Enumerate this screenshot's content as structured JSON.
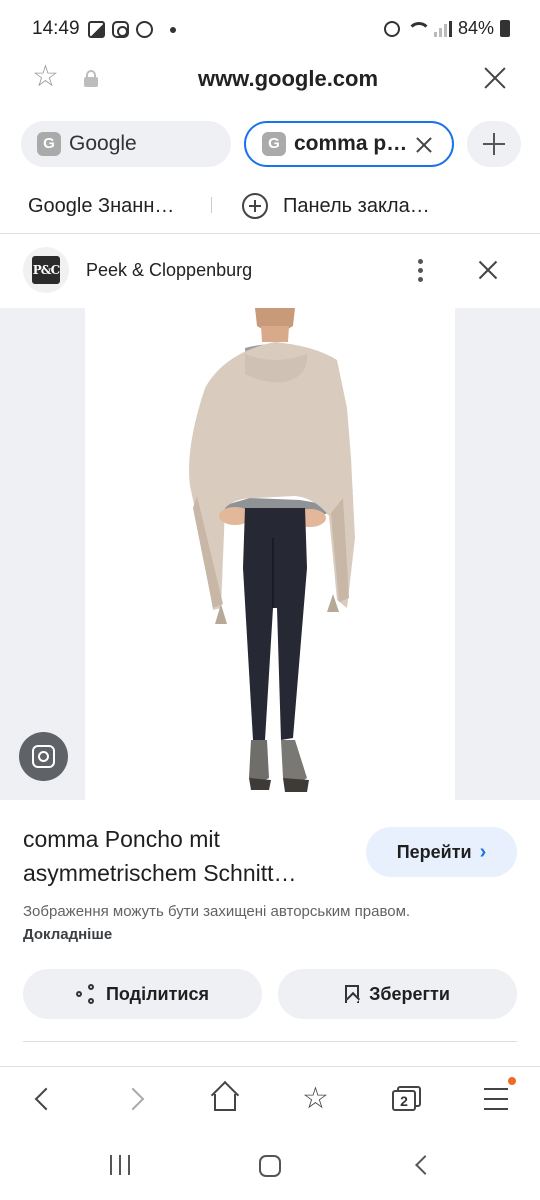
{
  "status_bar": {
    "time": "14:49",
    "battery": "84%",
    "icons_left": [
      "gallery-icon",
      "instagram-icon",
      "viber-icon",
      "dot-icon"
    ],
    "icons_right": [
      "alarm-icon",
      "wifi-icon",
      "signal-icon",
      "battery-icon"
    ]
  },
  "browser": {
    "url": "www.google.com",
    "tabs": [
      {
        "favicon": "G",
        "label": "Google"
      },
      {
        "favicon": "G",
        "label": "comma p…",
        "active": true
      }
    ],
    "bookmarks": [
      {
        "label": "Google Знанн…"
      },
      {
        "label": "Панель закла…"
      }
    ]
  },
  "result": {
    "source_logo": "P&C",
    "source_name": "Peek & Cloppenburg",
    "title": "comma Poncho mit asymmetrischem Schnitt…",
    "go_label": "Перейти",
    "copyright_text": "Зображення можуть бути захищені авторським правом.",
    "copyright_link": "Докладніше",
    "share_label": "Поділитися",
    "save_label": "Зберегти"
  },
  "bottom_nav": {
    "tab_count": "2"
  },
  "colors": {
    "accent": "#1a73e8",
    "go_button_bg": "#e8f0fe",
    "chip_bg": "#eef0f3",
    "badge": "#f06a23",
    "poncho": "#d9ccbf"
  }
}
